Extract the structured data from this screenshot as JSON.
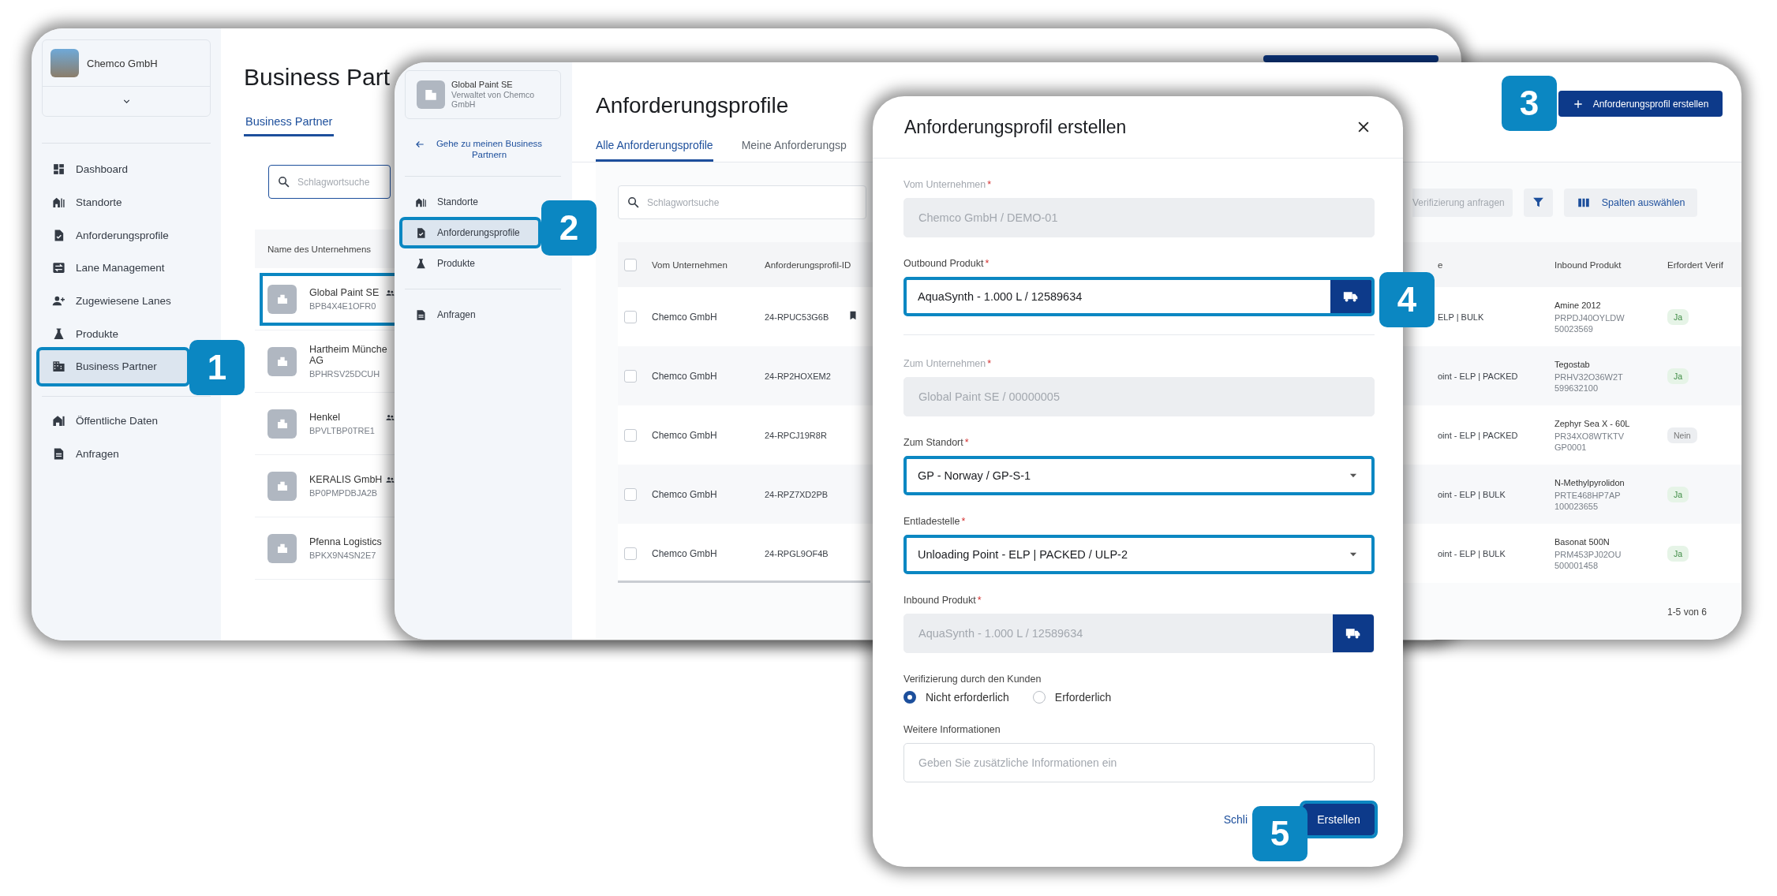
{
  "back_window": {
    "company": {
      "name": "Chemco GmbH"
    },
    "nav": [
      {
        "label": "Dashboard",
        "selected": false
      },
      {
        "label": "Standorte",
        "selected": false
      },
      {
        "label": "Anforderungsprofile",
        "selected": false
      },
      {
        "label": "Lane Management",
        "selected": false
      },
      {
        "label": "Zugewiesene Lanes",
        "selected": false
      },
      {
        "label": "Produkte",
        "selected": false
      },
      {
        "label": "Business Partner",
        "selected": true
      }
    ],
    "nav_secondary": [
      {
        "label": "Öffentliche Daten",
        "selected": false
      },
      {
        "label": "Anfragen",
        "selected": false
      }
    ],
    "title": "Business Part",
    "tabs": [
      {
        "label": "Business Partner",
        "selected": true
      }
    ],
    "search": {
      "placeholder": "Schlagwortsuche"
    },
    "column_header": "Name des Unternehmens",
    "partners": [
      {
        "name": "Global Paint SE",
        "id": "BPB4X4E1OFR0",
        "shared": true,
        "selected": true
      },
      {
        "name": "Hartheim Münche AG",
        "id": "BPHRSV25DCUH",
        "shared": false,
        "selected": false
      },
      {
        "name": "Henkel",
        "id": "BPVLTBP0TRE1",
        "shared": true,
        "selected": false
      },
      {
        "name": "KERALIS GmbH",
        "id": "BP0PMPDBJA2B",
        "shared": true,
        "selected": false
      },
      {
        "name": "Pfenna Logistics",
        "id": "BPKX9N4SN2E7",
        "shared": false,
        "selected": false
      }
    ]
  },
  "middle_window": {
    "company": {
      "name": "Global Paint SE",
      "subtitle": "Verwaltet von Chemco GmbH"
    },
    "back_link": "Gehe zu meinen Business Partnern",
    "nav": [
      {
        "label": "Standorte",
        "selected": false
      },
      {
        "label": "Anforderungsprofile",
        "selected": true
      },
      {
        "label": "Produkte",
        "selected": false
      }
    ],
    "nav_secondary": [
      {
        "label": "Anfragen",
        "selected": false
      }
    ],
    "title": "Anforderungsprofile",
    "create_button": "Anforderungsprofil erstellen",
    "tabs": [
      {
        "label": "Alle Anforderungsprofile",
        "selected": true
      },
      {
        "label": "Meine Anforderungsp",
        "selected": false
      }
    ],
    "search": {
      "placeholder": "Schlagwortsuche"
    },
    "toolbar": {
      "verify_button": "Verifizierung anfragen",
      "columns_button": "Spalten auswählen"
    },
    "table": {
      "all_checked": false,
      "columns": [
        "Vom Unternehmen",
        "Anforderungsprofil-ID",
        "e",
        "Inbound Produkt",
        "Erfordert Verif"
      ],
      "rows": [
        {
          "checked": false,
          "company": "Chemco GmbH",
          "profile_id": "24-RPUC53G6B",
          "bookmarked": true,
          "column_3": "ELP | BULK",
          "inbound_name": "Amine 2012",
          "inbound_id": "PRPDJ40OYLDW",
          "inbound_number": "50023569",
          "verification": "Ja",
          "required": true
        },
        {
          "checked": false,
          "company": "Chemco GmbH",
          "profile_id": "24-RP2HOXEM2",
          "bookmarked": false,
          "column_3": "oint - ELP | PACKED",
          "inbound_name": "Tegostab",
          "inbound_id": "PRHV32O36W2T",
          "inbound_number": "599632100",
          "verification": "Ja",
          "required": true
        },
        {
          "checked": false,
          "company": "Chemco GmbH",
          "profile_id": "24-RPCJ19R8R",
          "bookmarked": false,
          "column_3": "oint - ELP | PACKED",
          "inbound_name": "Zephyr Sea X - 60L",
          "inbound_id": "PR34XO8WTKTV",
          "inbound_number": "GP0001",
          "verification": "Nein",
          "required": false
        },
        {
          "checked": false,
          "company": "Chemco GmbH",
          "profile_id": "24-RPZ7XD2PB",
          "bookmarked": false,
          "column_3": "oint - ELP | BULK",
          "inbound_name": "N-Methylpyrolidon",
          "inbound_id": "PRTE468HP7AP",
          "inbound_number": "100023655",
          "verification": "Ja",
          "required": true
        },
        {
          "checked": false,
          "company": "Chemco GmbH",
          "profile_id": "24-RPGL9OF4B",
          "bookmarked": false,
          "column_3": "oint - ELP | BULK",
          "inbound_name": "Basonat 500N",
          "inbound_id": "PRM453PJ02OU",
          "inbound_number": "500001458",
          "verification": "Ja",
          "required": true
        }
      ]
    },
    "pagination": "1-5 von 6"
  },
  "dialog": {
    "title": "Anforderungsprofil erstellen",
    "fields": [
      {
        "kind": "readonly",
        "label": "Vom Unternehmen",
        "required_mark": "*",
        "value": "Chemco GmbH / DEMO-01",
        "highlighted": false,
        "separated": false
      },
      {
        "kind": "product",
        "label": "Outbound Produkt",
        "required_mark": "*",
        "value": "AquaSynth - 1.000 L / 12589634",
        "disabled": false,
        "highlighted": true,
        "separated": true
      },
      {
        "kind": "readonly",
        "label": "Zum Unternehmen",
        "required_mark": "*",
        "value": "Global Paint SE / 00000005",
        "highlighted": false,
        "separated": false
      },
      {
        "kind": "select",
        "label": "Zum Standort",
        "required_mark": "*",
        "value": "GP - Norway / GP-S-1",
        "highlighted": true,
        "separated": false
      },
      {
        "kind": "select",
        "label": "Entladestelle",
        "required_mark": "*",
        "value": "Unloading Point - ELP | PACKED / ULP-2",
        "highlighted": true,
        "separated": false
      },
      {
        "kind": "product",
        "label": "Inbound Produkt",
        "required_mark": "*",
        "value": "AquaSynth - 1.000 L / 12589634",
        "disabled": true,
        "highlighted": false,
        "separated": false
      }
    ],
    "verification": {
      "label": "Verifizierung durch den Kunden",
      "options": [
        {
          "label": "Nicht erforderlich",
          "selected": true
        },
        {
          "label": "Erforderlich",
          "selected": false
        }
      ]
    },
    "notes": {
      "label": "Weitere Informationen",
      "placeholder": "Geben Sie zusätzliche Informationen ein"
    },
    "cancel_button": "Schli",
    "submit_button": "Erstellen"
  },
  "callouts": [
    {
      "number": "1"
    },
    {
      "number": "2"
    },
    {
      "number": "3"
    },
    {
      "number": "4"
    },
    {
      "number": "5"
    }
  ]
}
